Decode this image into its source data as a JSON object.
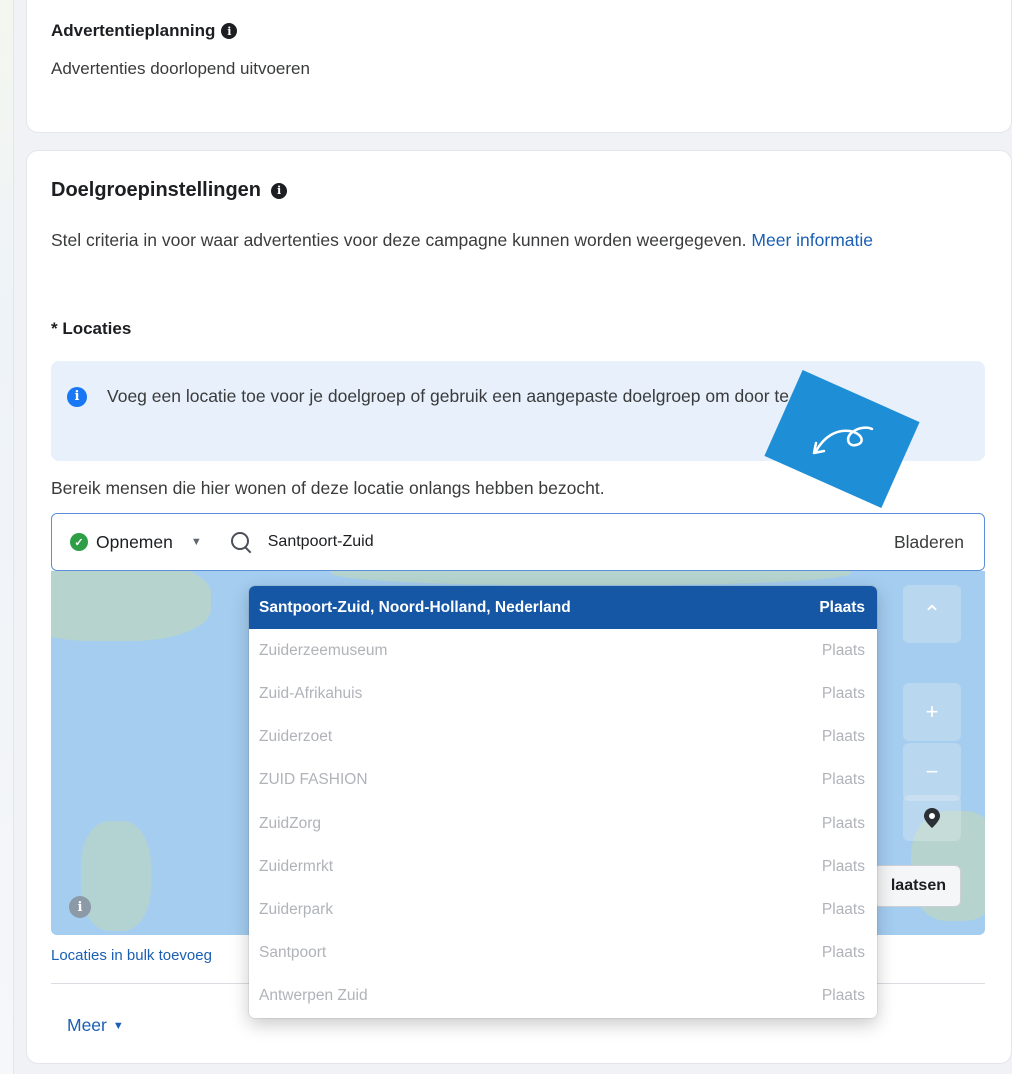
{
  "schedule": {
    "title": "Advertentieplanning",
    "value": "Advertenties doorlopend uitvoeren"
  },
  "audience": {
    "title": "Doelgroepinstellingen",
    "description": "Stel criteria in voor waar advertenties voor deze campagne kunnen worden weergegeven.",
    "more_info_link": "Meer informatie",
    "locations_label": "* Locaties",
    "notice": "Voeg een locatie toe voor je doelgroep of gebruik een aangepaste doelgroep om door te gaan.",
    "reach_text": "Bereik mensen die hier wonen of deze locatie onlangs hebben bezocht."
  },
  "location_bar": {
    "include_label": "Opnemen",
    "search_value": "Santpoort-Zuid",
    "browse_label": "Bladeren"
  },
  "map": {
    "place_button_label": "laatsen"
  },
  "dropdown": {
    "items": [
      {
        "name": "Santpoort-Zuid, Noord-Holland, Nederland",
        "type": "Plaats",
        "selected": true
      },
      {
        "name": "Zuiderzeemuseum",
        "type": "Plaats",
        "selected": false
      },
      {
        "name": "Zuid-Afrikahuis",
        "type": "Plaats",
        "selected": false
      },
      {
        "name": "Zuiderzoet",
        "type": "Plaats",
        "selected": false
      },
      {
        "name": "ZUID FASHION",
        "type": "Plaats",
        "selected": false
      },
      {
        "name": "ZuidZorg",
        "type": "Plaats",
        "selected": false
      },
      {
        "name": "Zuidermrkt",
        "type": "Plaats",
        "selected": false
      },
      {
        "name": "Zuiderpark",
        "type": "Plaats",
        "selected": false
      },
      {
        "name": "Santpoort",
        "type": "Plaats",
        "selected": false
      },
      {
        "name": "Antwerpen Zuid",
        "type": "Plaats",
        "selected": false
      }
    ]
  },
  "footer": {
    "bulk_link": "Locaties in bulk toevoeg",
    "more_label": "Meer"
  },
  "colors": {
    "accent": "#1877f2",
    "link": "#1a5fb4",
    "selected_row": "#1557a5",
    "map_water": "#a4cdf0",
    "badge": "#1e8ed6",
    "include_check": "#2e9e47"
  }
}
